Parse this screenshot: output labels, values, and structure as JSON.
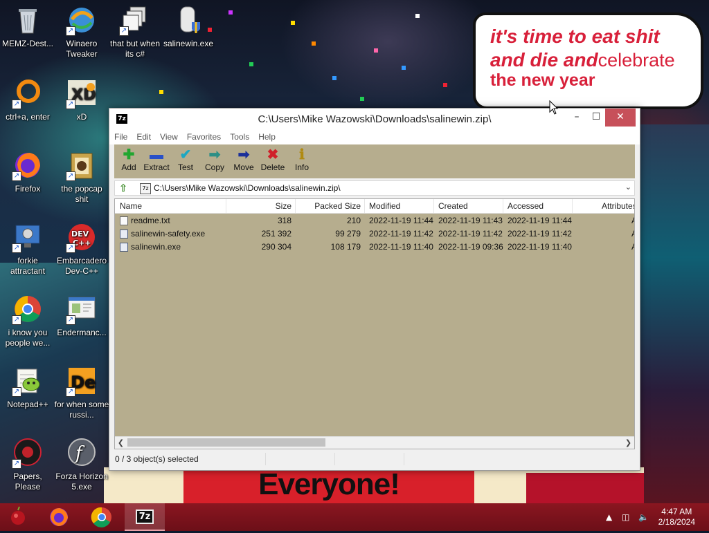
{
  "desktop": {
    "icons": [
      {
        "label": "MEMZ-Dest..."
      },
      {
        "label": "Winaero Tweaker"
      },
      {
        "label": "that but when its c#"
      },
      {
        "label": "salinewin.exe"
      },
      {
        "label": "ctrl+a, enter"
      },
      {
        "label": "xD"
      },
      {
        "label": "Firefox"
      },
      {
        "label": "the popcap shit"
      },
      {
        "label": "forkie attractant"
      },
      {
        "label": "Embarcadero Dev-C++"
      },
      {
        "label": "i know you people we..."
      },
      {
        "label": "Endermanc..."
      },
      {
        "label": "Notepad++"
      },
      {
        "label": "for when some russi..."
      },
      {
        "label": "Papers, Please"
      },
      {
        "label": "Forza Horizon 5.exe"
      }
    ]
  },
  "wallpaper": {
    "speech_line1": "it's time to eat shit",
    "speech_line2": "and die and",
    "speech_line2b": "celebrate",
    "speech_line3": "the new year",
    "banner": "Everyone!"
  },
  "window": {
    "app_icon_text": "7z",
    "title": "C:\\Users\\Mike Wazowski\\Downloads\\salinewin.zip\\",
    "menu": [
      "File",
      "Edit",
      "View",
      "Favorites",
      "Tools",
      "Help"
    ],
    "toolbar": [
      {
        "label": "Add",
        "icon": "add-icon",
        "glyph": "✚",
        "color": "#21a630"
      },
      {
        "label": "Extract",
        "icon": "extract-icon",
        "glyph": "▬",
        "color": "#2850c8"
      },
      {
        "label": "Test",
        "icon": "test-icon",
        "glyph": "✔",
        "color": "#1ba7c2"
      },
      {
        "label": "Copy",
        "icon": "copy-icon",
        "glyph": "➡",
        "color": "#2c8f86"
      },
      {
        "label": "Move",
        "icon": "move-icon",
        "glyph": "➡",
        "color": "#1a2f9a"
      },
      {
        "label": "Delete",
        "icon": "delete-icon",
        "glyph": "✖",
        "color": "#d0202a"
      },
      {
        "label": "Info",
        "icon": "info-icon",
        "glyph": "ℹ",
        "color": "#b08a10"
      }
    ],
    "address": "C:\\Users\\Mike Wazowski\\Downloads\\salinewin.zip\\",
    "columns": [
      "Name",
      "Size",
      "Packed Size",
      "Modified",
      "Created",
      "Accessed",
      "Attributes"
    ],
    "rows": [
      {
        "name": "readme.txt",
        "size": "318",
        "packed": "210",
        "modified": "2022-11-19 11:44",
        "created": "2022-11-19 11:43",
        "accessed": "2022-11-19 11:44",
        "attr": "A",
        "type": "txt"
      },
      {
        "name": "salinewin-safety.exe",
        "size": "251 392",
        "packed": "99 279",
        "modified": "2022-11-19 11:42",
        "created": "2022-11-19 11:42",
        "accessed": "2022-11-19 11:42",
        "attr": "A",
        "type": "exe"
      },
      {
        "name": "salinewin.exe",
        "size": "290 304",
        "packed": "108 179",
        "modified": "2022-11-19 11:40",
        "created": "2022-11-19 09:36",
        "accessed": "2022-11-19 11:40",
        "attr": "A",
        "type": "exe"
      }
    ],
    "status": "0 / 3 object(s) selected",
    "background_color": "#b6ad8e"
  },
  "taskbar": {
    "apps": [
      "start-icon",
      "firefox-icon",
      "chrome-icon",
      "7zip-icon"
    ],
    "active_app": "7z",
    "time": "4:47 AM",
    "date": "2/18/2024"
  }
}
